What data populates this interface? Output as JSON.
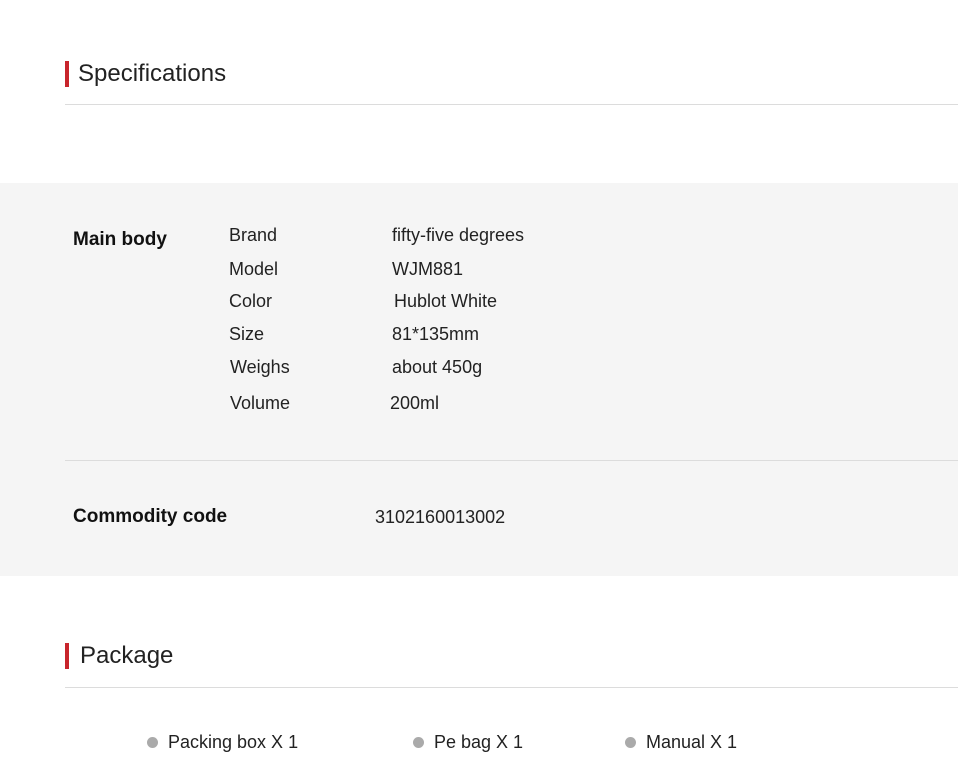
{
  "specifications": {
    "title": "Specifications",
    "main_body_label": "Main body",
    "rows": [
      {
        "name": "Brand",
        "value": "fifty-five degrees"
      },
      {
        "name": "Model",
        "value": "WJM881"
      },
      {
        "name": "Color",
        "value": "Hublot White"
      },
      {
        "name": "Size",
        "value": "81*135mm"
      },
      {
        "name": "Weighs",
        "value": "about 450g"
      },
      {
        "name": "Volume",
        "value": "200ml"
      }
    ],
    "commodity_code_label": "Commodity code",
    "commodity_code_value": "3102160013002"
  },
  "package": {
    "title": "Package",
    "items": [
      "Packing box X 1",
      "Pe bag X 1",
      "Manual X 1"
    ]
  },
  "colors": {
    "accent": "#c8252c",
    "panel": "#f5f5f5",
    "rule": "#dcdcdc",
    "bullet": "#aaaaaa"
  }
}
